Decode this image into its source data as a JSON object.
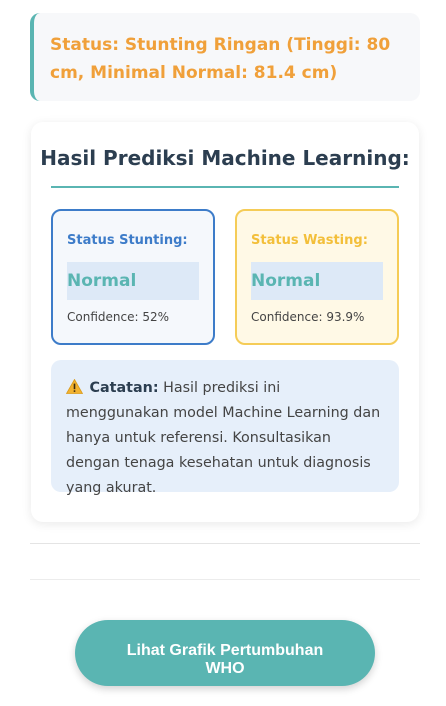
{
  "status": {
    "text": "Status: Stunting Ringan (Tinggi: 80 cm, Minimal Normal: 81.4 cm)",
    "color": "#f0a03a"
  },
  "prediction": {
    "title": "Hasil Prediksi Machine Learning:",
    "stunting": {
      "label": "Status Stunting:",
      "value": "Normal",
      "confidence": "Confidence: 52%"
    },
    "wasting": {
      "label": "Status Wasting:",
      "value": "Normal",
      "confidence": "Confidence: 93.9%"
    },
    "note": {
      "icon": "warning-icon",
      "label": "Catatan:",
      "text": " Hasil prediksi ini menggunakan model Machine Learning dan hanya untuk referensi. Konsultasikan dengan tenaga kesehatan untuk diagnosis yang akurat."
    }
  },
  "actions": {
    "who_chart_label": "Lihat Grafik Pertumbuhan WHO"
  },
  "colors": {
    "accent": "#5ab5b2",
    "stunting": "#3d7cc9",
    "wasting": "#f3bf3a"
  }
}
